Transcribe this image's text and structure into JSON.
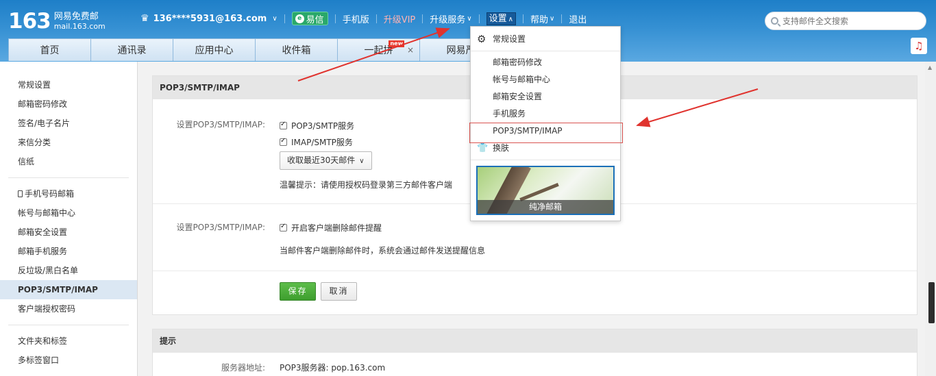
{
  "header": {
    "logo_number": "163",
    "logo_line1": "网易免费邮",
    "logo_line2": "mail.163.com",
    "account": "136****5931@163.com",
    "yixin": "易信",
    "mobile": "手机版",
    "vip": "升级VIP",
    "upgrade_service": "升级服务",
    "settings": "设置",
    "help": "帮助",
    "logout": "退出",
    "search_placeholder": "支持邮件全文搜索"
  },
  "tabs": [
    {
      "label": "首页"
    },
    {
      "label": "通讯录"
    },
    {
      "label": "应用中心"
    },
    {
      "label": "收件箱"
    },
    {
      "label": "一起拼",
      "badge": "new"
    },
    {
      "label": "网易严"
    }
  ],
  "sidebar": {
    "group1": [
      "常规设置",
      "邮箱密码修改",
      "签名/电子名片",
      "来信分类",
      "信纸"
    ],
    "group2": [
      "手机号码邮箱",
      "帐号与邮箱中心",
      "邮箱安全设置",
      "邮箱手机服务",
      "反垃圾/黑白名单",
      "POP3/SMTP/IMAP",
      "客户端授权密码"
    ],
    "group3": [
      "文件夹和标签",
      "多标签窗口"
    ],
    "active": "POP3/SMTP/IMAP"
  },
  "panel1": {
    "title": "POP3/SMTP/IMAP",
    "row1_label": "设置POP3/SMTP/IMAP:",
    "pop3_label": "POP3/SMTP服务",
    "imap_label": "IMAP/SMTP服务",
    "select_value": "收取最近30天邮件",
    "tip": "温馨提示：请使用授权码登录第三方邮件客户端",
    "row2_label": "设置POP3/SMTP/IMAP:",
    "delete_notify_label": "开启客户端删除邮件提醒",
    "delete_notify_desc": "当邮件客户端删除邮件时，系统会通过邮件发送提醒信息",
    "save": "保存",
    "cancel": "取消"
  },
  "panel2": {
    "title": "提示",
    "server_label": "服务器地址:",
    "server_value": "POP3服务器: pop.163.com"
  },
  "menu": {
    "head": "常规设置",
    "items": [
      "邮箱密码修改",
      "帐号与邮箱中心",
      "邮箱安全设置",
      "手机服务",
      "POP3/SMTP/IMAP"
    ],
    "skin": "换肤",
    "skin_caption": "纯净邮箱"
  },
  "colors": {
    "header_blue": "#3590d3",
    "save_green": "#4caf3a",
    "highlight_red": "#d9534f"
  }
}
